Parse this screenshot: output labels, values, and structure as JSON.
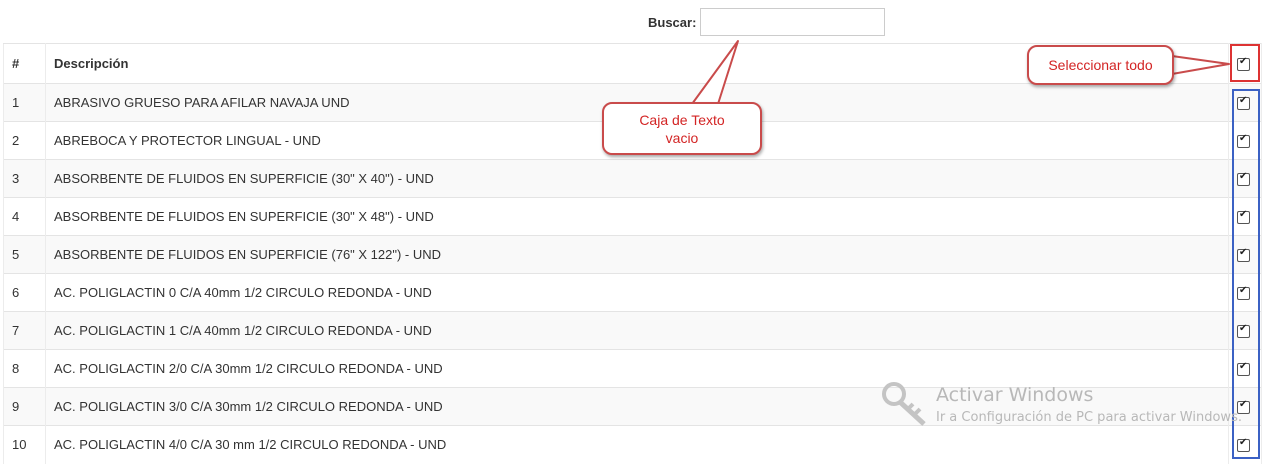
{
  "search": {
    "label": "Buscar:",
    "value": ""
  },
  "table": {
    "headers": {
      "num": "#",
      "desc": "Descripción"
    },
    "rows": [
      {
        "num": "1",
        "desc": "ABRASIVO GRUESO PARA AFILAR NAVAJA UND",
        "checked": true
      },
      {
        "num": "2",
        "desc": "ABREBOCA Y PROTECTOR LINGUAL - UND",
        "checked": true
      },
      {
        "num": "3",
        "desc": "ABSORBENTE DE FLUIDOS EN SUPERFICIE (30\" X 40\") - UND",
        "checked": true
      },
      {
        "num": "4",
        "desc": "ABSORBENTE DE FLUIDOS EN SUPERFICIE (30\" X 48\") - UND",
        "checked": true
      },
      {
        "num": "5",
        "desc": "ABSORBENTE DE FLUIDOS EN SUPERFICIE (76\" X 122\") - UND",
        "checked": true
      },
      {
        "num": "6",
        "desc": "AC. POLIGLACTIN 0 C/A 40mm 1/2 CIRCULO REDONDA - UND",
        "checked": true
      },
      {
        "num": "7",
        "desc": "AC. POLIGLACTIN 1 C/A 40mm 1/2 CIRCULO REDONDA - UND",
        "checked": true
      },
      {
        "num": "8",
        "desc": "AC. POLIGLACTIN 2/0 C/A 30mm 1/2 CIRCULO REDONDA - UND",
        "checked": true
      },
      {
        "num": "9",
        "desc": "AC. POLIGLACTIN 3/0 C/A 30mm 1/2 CIRCULO REDONDA - UND",
        "checked": true
      },
      {
        "num": "10",
        "desc": "AC. POLIGLACTIN 4/0 C/A 30 mm 1/2 CIRCULO REDONDA - UND",
        "checked": true
      }
    ]
  },
  "annotations": {
    "select_all": "Seleccionar todo",
    "empty_box_line1": "Caja de Texto",
    "empty_box_line2": "vacio",
    "colors": {
      "red": "#d32424",
      "blue": "#3b61c4"
    }
  },
  "watermark": {
    "title": "Activar Windows",
    "subtitle": "Ir a Configuración de PC para activar Windows."
  }
}
